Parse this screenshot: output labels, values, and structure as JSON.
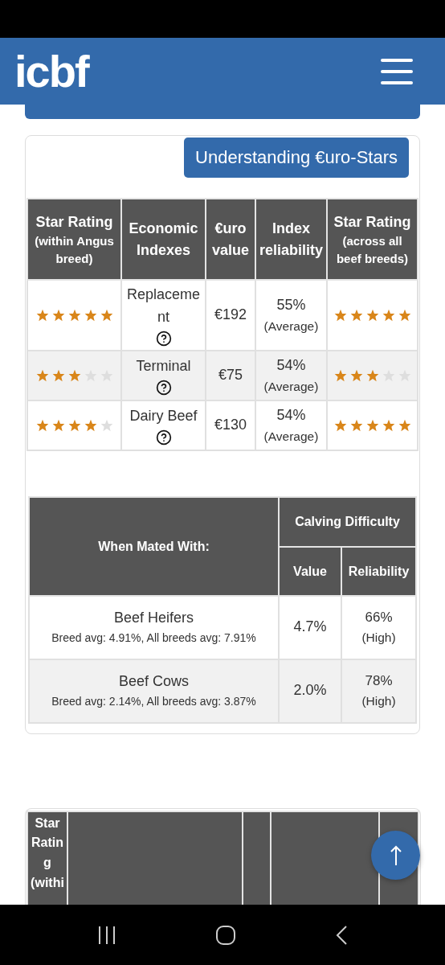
{
  "header": {
    "logo": "icbf"
  },
  "euro_stars": {
    "button": "Understanding €uro-Stars",
    "columns": [
      {
        "title": "Star Rating",
        "subtitle": "(within Angus breed)"
      },
      {
        "title": "Economic Indexes"
      },
      {
        "title": "€uro value"
      },
      {
        "title": "Index reliability"
      },
      {
        "title": "Star Rating",
        "subtitle": "(across all beef breeds)"
      }
    ],
    "rows": [
      {
        "index": "Replacement",
        "value": "€192",
        "reliability": "55%",
        "reliability_label": "(Average)",
        "breed_rating": {
          "stars": 5
        },
        "all_rating": {
          "stars": 5
        }
      },
      {
        "index": "Terminal",
        "value": "€75",
        "reliability": "54%",
        "reliability_label": "(Average)",
        "breed_rating": {
          "stars": 3
        },
        "all_rating": {
          "stars": 3
        }
      },
      {
        "index": "Dairy Beef",
        "value": "€130",
        "reliability": "54%",
        "reliability_label": "(Average)",
        "breed_rating": {
          "stars": 4
        },
        "all_rating": {
          "stars": 5
        }
      }
    ]
  },
  "calving": {
    "group_heading": "When Mated With:",
    "title": "Calving Difficulty",
    "value_heading": "Value",
    "reliability_heading": "Reliability",
    "rows": [
      {
        "name": "Beef Heifers",
        "averages": "Breed avg: 4.91%, All breeds avg: 7.91%",
        "value": "4.7%",
        "reliability": "66%",
        "reliability_label": "(High)"
      },
      {
        "name": "Beef Cows",
        "averages": "Breed avg: 2.14%, All breeds avg: 3.87%",
        "value": "2.0%",
        "reliability": "78%",
        "reliability_label": "(High)"
      }
    ]
  },
  "next_table": {
    "first_heading": "Star Rating (withi"
  }
}
